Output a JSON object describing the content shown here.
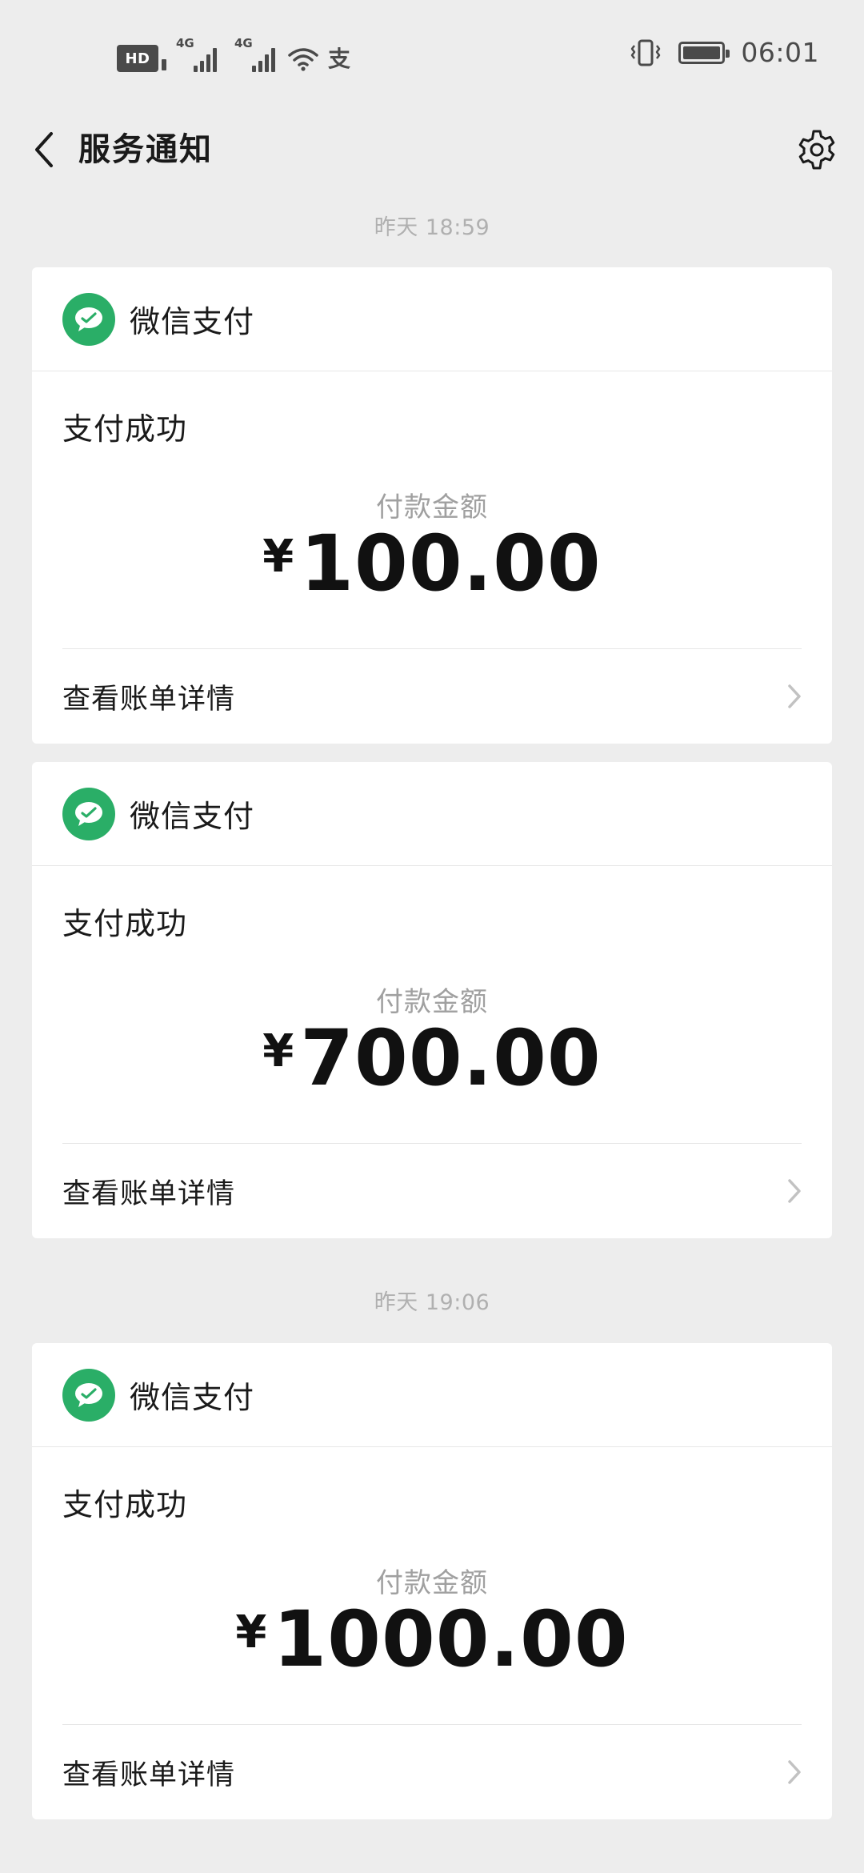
{
  "status_bar": {
    "hd_label": "HD",
    "network_1": "4G",
    "network_2": "4G",
    "alipay_glyph": "支",
    "time": "06:01",
    "icons": [
      "hd-icon",
      "signal-icon",
      "signal-icon",
      "wifi-icon",
      "alipay-icon",
      "vibrate-icon",
      "battery-icon"
    ]
  },
  "nav": {
    "title": "服务通知",
    "back_icon": "chevron-left-icon",
    "settings_icon": "gear-icon"
  },
  "groups": [
    {
      "timestamp": "昨天 18:59"
    },
    {
      "timestamp": "昨天 19:06"
    }
  ],
  "cards": [
    {
      "app_name": "微信支付",
      "title": "支付成功",
      "amount_label": "付款金额",
      "currency": "¥",
      "amount": "100.00",
      "link_label": "查看账单详情"
    },
    {
      "app_name": "微信支付",
      "title": "支付成功",
      "amount_label": "付款金额",
      "currency": "¥",
      "amount": "700.00",
      "link_label": "查看账单详情"
    },
    {
      "app_name": "微信支付",
      "title": "支付成功",
      "amount_label": "付款金额",
      "currency": "¥",
      "amount": "1000.00",
      "link_label": "查看账单详情"
    }
  ],
  "colors": {
    "background": "#ededed",
    "card": "#ffffff",
    "wechat_pay_green": "#2aae67",
    "muted_text": "#a0a0a0",
    "timestamp_text": "#b0b0b0"
  }
}
